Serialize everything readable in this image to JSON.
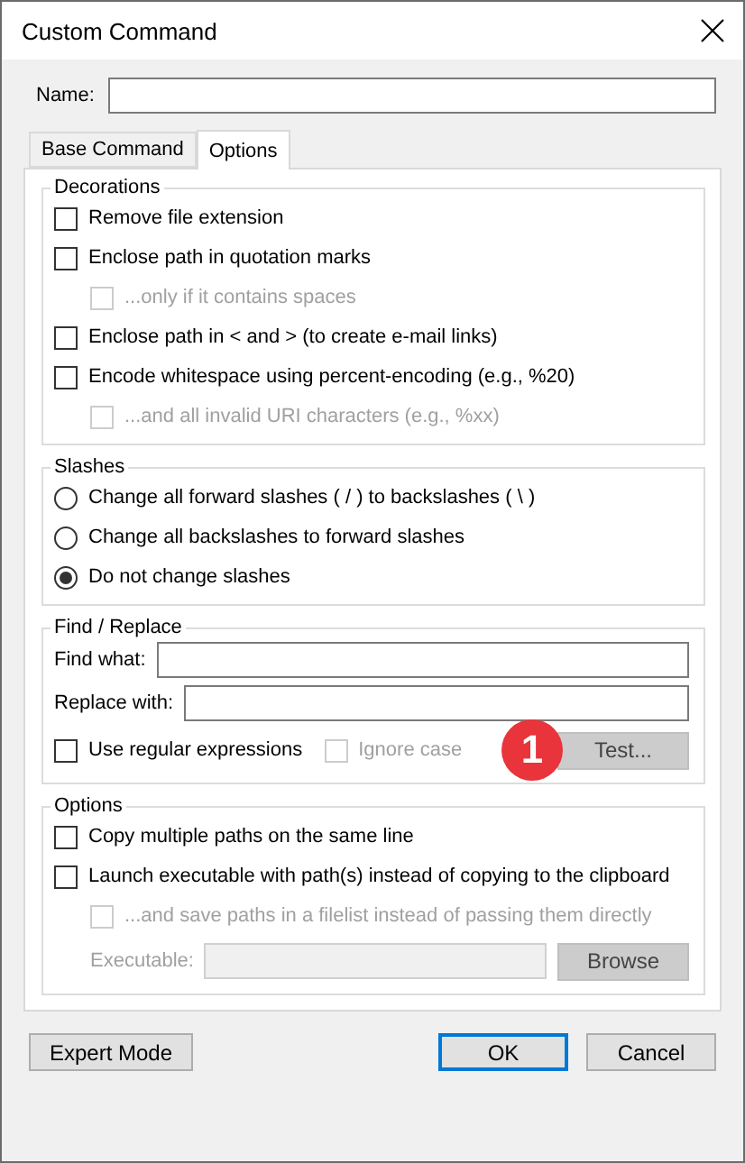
{
  "window": {
    "title": "Custom Command"
  },
  "name_field": {
    "label": "Name:"
  },
  "tabs": [
    {
      "label": "Base Command",
      "selected": false
    },
    {
      "label": "Options",
      "selected": true
    }
  ],
  "decorations": {
    "title": "Decorations",
    "items": [
      {
        "label": "Remove file extension",
        "checked": false,
        "disabled": false
      },
      {
        "label": "Enclose path in quotation marks",
        "checked": false,
        "disabled": false,
        "children": [
          {
            "label": "...only if it contains spaces",
            "checked": false,
            "disabled": true
          }
        ]
      },
      {
        "label": "Enclose path in < and > (to create e-mail links)",
        "checked": false,
        "disabled": false
      },
      {
        "label": "Encode whitespace using percent-encoding (e.g., %20)",
        "checked": false,
        "disabled": false,
        "children": [
          {
            "label": "...and all invalid URI characters (e.g., %xx)",
            "checked": false,
            "disabled": true
          }
        ]
      }
    ]
  },
  "slashes": {
    "title": "Slashes",
    "options": [
      {
        "label": "Change all forward slashes ( / ) to backslashes ( \\ )",
        "selected": false
      },
      {
        "label": "Change all backslashes to forward slashes",
        "selected": false
      },
      {
        "label": "Do not change slashes",
        "selected": true
      }
    ]
  },
  "find_replace": {
    "title": "Find / Replace",
    "fields": [
      {
        "label": "Find what:"
      },
      {
        "label": "Replace with:"
      }
    ],
    "checks": [
      {
        "label": "Use regular expressions",
        "checked": false,
        "disabled": false
      },
      {
        "label": "Ignore case",
        "checked": false,
        "disabled": true
      }
    ],
    "test_button": {
      "label": "Test...",
      "disabled": true
    },
    "callout": "1"
  },
  "options": {
    "title": "Options",
    "items": [
      {
        "label": "Copy multiple paths on the same line",
        "checked": false,
        "disabled": false
      },
      {
        "label": "Launch executable with path(s) instead of copying to the clipboard",
        "checked": false,
        "disabled": false,
        "children": [
          {
            "label": "...and save paths in a filelist instead of passing them directly",
            "checked": false,
            "disabled": true
          }
        ]
      }
    ],
    "executable": {
      "label": "Executable:",
      "disabled": true
    },
    "browse_button": {
      "label": "Browse",
      "disabled": true
    }
  },
  "footer": [
    {
      "label": "Expert Mode",
      "default": false
    },
    {
      "label": "OK",
      "default": true
    },
    {
      "label": "Cancel",
      "default": false
    }
  ]
}
